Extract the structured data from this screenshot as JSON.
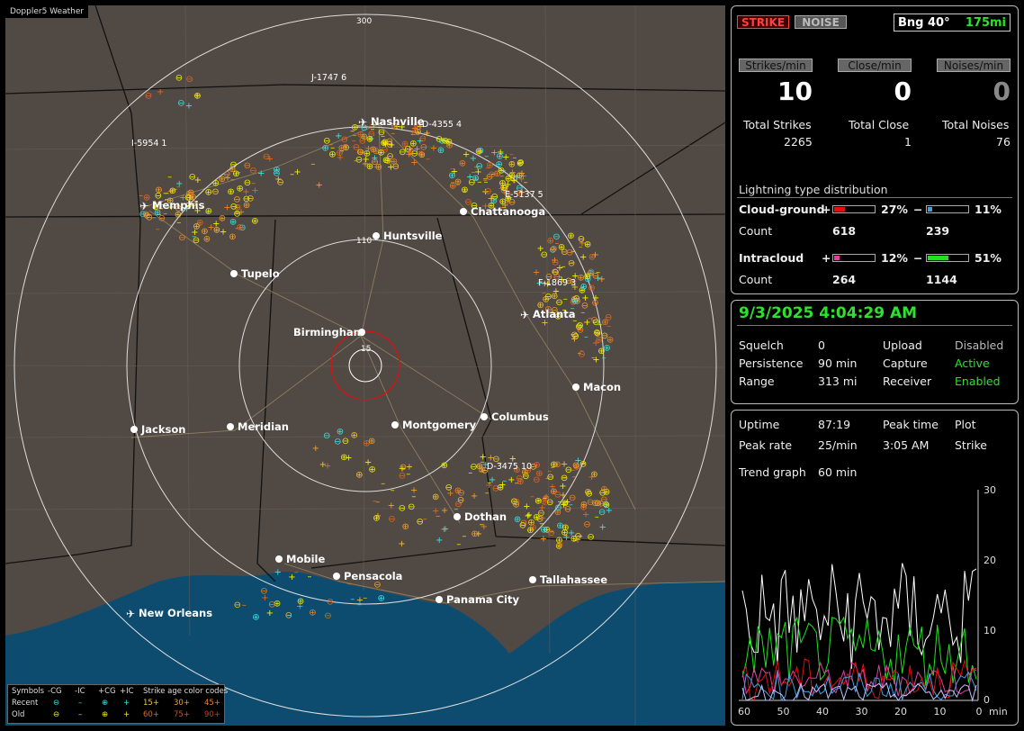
{
  "app": {
    "title": "Doppler5 Weather"
  },
  "map": {
    "range_labels": [
      "300",
      "110",
      "15"
    ],
    "cities": [
      {
        "name": "Nashville",
        "marker": "airport"
      },
      {
        "name": "Memphis",
        "marker": "airport"
      },
      {
        "name": "Chattanooga",
        "marker": "dot"
      },
      {
        "name": "Huntsville",
        "marker": "dot"
      },
      {
        "name": "Tupelo",
        "marker": "dot"
      },
      {
        "name": "Atlanta",
        "marker": "airport"
      },
      {
        "name": "Birmingham",
        "marker": "dot"
      },
      {
        "name": "Macon",
        "marker": "dot"
      },
      {
        "name": "Jackson",
        "marker": "dot"
      },
      {
        "name": "Meridian",
        "marker": "dot"
      },
      {
        "name": "Montgomery",
        "marker": "dot"
      },
      {
        "name": "Columbus",
        "marker": "dot"
      },
      {
        "name": "Dothan",
        "marker": "dot"
      },
      {
        "name": "Mobile",
        "marker": "dot"
      },
      {
        "name": "Pensacola",
        "marker": "dot"
      },
      {
        "name": "Tallahassee",
        "marker": "dot"
      },
      {
        "name": "Panama City",
        "marker": "dot"
      },
      {
        "name": "New Orleans",
        "marker": "airport"
      }
    ],
    "cluster_labels": [
      {
        "id": "J-1747",
        "count": "6"
      },
      {
        "id": "D-4355",
        "count": "4"
      },
      {
        "id": "I-5954",
        "count": "1"
      },
      {
        "id": "E-5137",
        "count": "5"
      },
      {
        "id": "F-1869",
        "count": "3"
      },
      {
        "id": "D-3475",
        "count": "10"
      }
    ]
  },
  "legend": {
    "title": "Symbols",
    "headers": [
      "-CG",
      "-IC",
      "+CG",
      "+IC"
    ],
    "age_title": "Strike age color codes",
    "rows": [
      {
        "label": "Recent",
        "ages": [
          "15+",
          "30+",
          "45+"
        ]
      },
      {
        "label": "Old",
        "ages": [
          "60+",
          "75+",
          "90+"
        ]
      }
    ],
    "colors": {
      "recent": "#40e0e0",
      "old": "#f0f000",
      "15": "#f0c040",
      "30": "#f0a030",
      "45": "#f08020",
      "60": "#e06820",
      "75": "#d05020",
      "90": "#c04020"
    }
  },
  "status": {
    "strike_btn": "STRIKE",
    "noise_btn": "NOISE",
    "bearing": "Bng 40°",
    "distance": "175mi",
    "rates": [
      {
        "label": "Strikes/min",
        "value": "10"
      },
      {
        "label": "Close/min",
        "value": "0"
      },
      {
        "label": "Noises/min",
        "value": "0"
      }
    ],
    "totals": [
      {
        "label": "Total Strikes",
        "value": "2265"
      },
      {
        "label": "Total Close",
        "value": "1"
      },
      {
        "label": "Total Noises",
        "value": "76"
      }
    ],
    "dist_title": "Lightning type distribution",
    "cloud_ground": {
      "label": "Cloud-ground",
      "pos_pct": "27%",
      "pos_fill": 0.27,
      "neg_pct": "11%",
      "neg_fill": 0.11,
      "count_label": "Count",
      "pos_count": "618",
      "neg_count": "239"
    },
    "intracloud": {
      "label": "Intracloud",
      "pos_pct": "12%",
      "pos_fill": 0.12,
      "neg_pct": "51%",
      "neg_fill": 0.51,
      "count_label": "Count",
      "pos_count": "264",
      "neg_count": "1144"
    },
    "plus": "+",
    "minus": "−",
    "colors": {
      "cg_pos": "#e01010",
      "cg_neg": "#40a0e0",
      "ic_pos": "#e040a0",
      "ic_neg": "#20e020"
    }
  },
  "settings": {
    "datetime": "9/3/2025 4:04:29 AM",
    "rows": [
      {
        "k1": "Squelch",
        "v1": "0",
        "k2": "Upload",
        "v2": "Disabled",
        "v2color": "#bbb"
      },
      {
        "k1": "Persistence",
        "v1": "90 min",
        "k2": "Capture",
        "v2": "Active",
        "v2color": "#30e030"
      },
      {
        "k1": "Range",
        "v1": "313 mi",
        "k2": "Receiver",
        "v2": "Enabled",
        "v2color": "#30e030"
      }
    ]
  },
  "trend": {
    "uptime_label": "Uptime",
    "uptime": "87:19",
    "peak_time_label": "Peak time",
    "peak_time": "3:05 AM",
    "plot_label": "Plot",
    "plot": "Strike",
    "peak_rate_label": "Peak rate",
    "peak_rate": "25/min",
    "trend_label": "Trend graph",
    "trend": "60 min",
    "y_ticks": [
      "30",
      "20",
      "10",
      "0"
    ],
    "x_ticks": [
      "60",
      "50",
      "40",
      "30",
      "20",
      "10",
      "0",
      "min"
    ]
  }
}
